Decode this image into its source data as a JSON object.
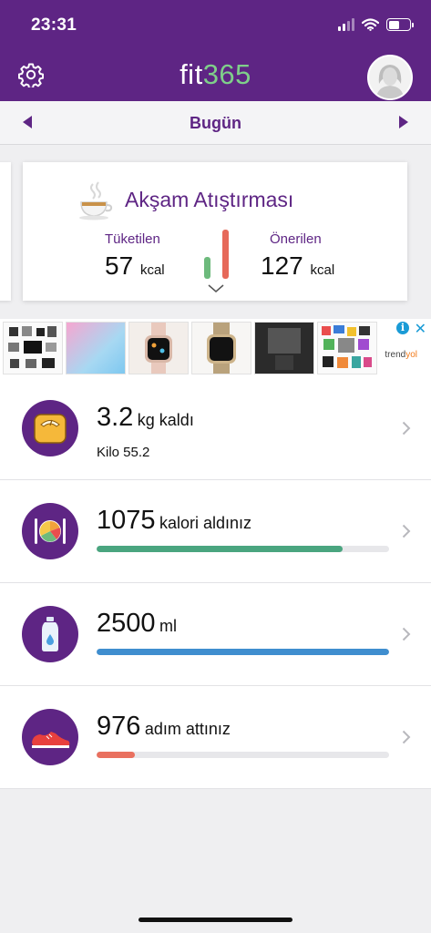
{
  "status_bar": {
    "time": "23:31"
  },
  "header": {
    "logo_prefix": "fit",
    "logo_suffix": "365"
  },
  "date_nav": {
    "title": "Bugün"
  },
  "meal_card": {
    "title": "Akşam Atıştırması",
    "consumed_label": "Tüketilen",
    "consumed_value": "57",
    "consumed_unit": "kcal",
    "recommended_label": "Önerilen",
    "recommended_value": "127",
    "recommended_unit": "kcal",
    "consumed_ratio": 0.45
  },
  "ad": {
    "brand_prefix": "trend",
    "brand_suffix": "yol",
    "info_glyph": "i",
    "close_glyph": "✕"
  },
  "rows": [
    {
      "value": "3.2",
      "label": "kg kaldı",
      "sub": "Kilo 55.2",
      "icon": "scale-icon"
    },
    {
      "value": "1075",
      "label": "kalori aldınız",
      "progress": 0.84,
      "color": "#4aa57f",
      "icon": "plate-icon"
    },
    {
      "value": "2500",
      "label": "ml",
      "progress": 1.0,
      "color": "#3f8ecf",
      "icon": "water-bottle-icon"
    },
    {
      "value": "976",
      "label": "adım attınız",
      "progress": 0.13,
      "color": "#e9705f",
      "icon": "sneaker-icon"
    }
  ],
  "colors": {
    "brand": "#5e2584",
    "accent_green": "#7fcf8a",
    "consumed": "#6dba7c",
    "recommended": "#e6695a"
  }
}
